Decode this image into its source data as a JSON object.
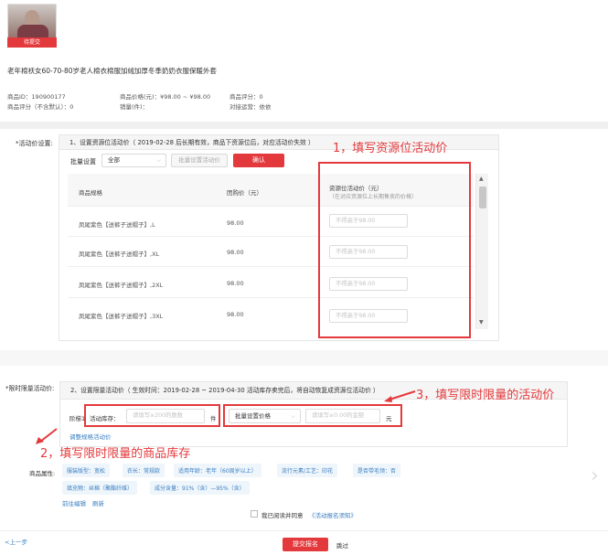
{
  "product": {
    "thumb_button": "待提交",
    "title": "老年棉袄女60-70-80岁老人棉衣棉服加绒加厚冬季奶奶衣服保暖外套",
    "meta": [
      {
        "label": "商品ID：190900177"
      },
      {
        "label": "商品价格(元)：¥98.00 ~ ¥98.00"
      },
      {
        "label": "商品评分：0"
      },
      {
        "label": "商品评分（不含默认）：0"
      },
      {
        "label": "销量(件)："
      },
      {
        "label": "对接运营：依依"
      }
    ]
  },
  "activity_price": {
    "section_label": "*活动价设置:",
    "panel_title": "1、设置资源位活动价（ 2019-02-28 后长期有效，商品下资源位后，对应活动价失效 ）",
    "batch_label": "批量设置",
    "batch_select": "全部",
    "batch_placeholder": "批量设置活动价",
    "confirm_button": "确认",
    "columns": {
      "spec": "商品规格",
      "group_price": "团购价（元）",
      "resource_price": "资源位活动价（元）",
      "resource_price_note": "（在对应资源位上长期售卖的价格）"
    },
    "rows": [
      {
        "spec": "凤尾紫色【送裤子送帽子】,L",
        "price": "98.00",
        "placeholder": "不得高于98.00"
      },
      {
        "spec": "凤尾紫色【送裤子送帽子】,XL",
        "price": "98.00",
        "placeholder": "不得高于98.00"
      },
      {
        "spec": "凤尾紫色【送裤子送帽子】,2XL",
        "price": "98.00",
        "placeholder": "不得高于98.00"
      },
      {
        "spec": "凤尾紫色【送裤子送帽子】,3XL",
        "price": "98.00",
        "placeholder": "不得高于98.00"
      }
    ]
  },
  "limited": {
    "section_label": "*限时限量活动价:",
    "panel_title": "2、设置限量活动价（ 生效时间：2019-02-28 ~ 2019-04-30 活动库存卖完后，将自动恢复成资源位活动价 ）",
    "stage_label": "阶梯1",
    "stock_label": "活动库存：",
    "stock_placeholder": "请填写≥200的数数",
    "stock_unit": "件",
    "price_select": "批量设置价格",
    "price_placeholder": "请填写≤0.00的金额",
    "price_unit": "元",
    "adjust_link": "调整规格活动价"
  },
  "attributes": {
    "label": "商品属性:",
    "tags": [
      "服装版型：宽松",
      "衣长：常规款",
      "适用年龄：老年（60周岁以上）",
      "流行元素/工艺：印花",
      "是否带毛领：否",
      "填充物：丝棉（聚酯纤维）",
      "成分含量：91%（含）—95%（含）"
    ],
    "edit_link": "前往编辑",
    "refresh_link": "刷新"
  },
  "footer": {
    "agree_text": "我已阅读并同意",
    "agree_link": "《活动报名须知》",
    "prev_link": "<上一步",
    "submit_button": "提交报名",
    "skip_link": "跳过"
  },
  "annotations": {
    "a1": "1，填写资源位活动价",
    "a2": "2，填写限时限量的商品库存",
    "a3": "3，填写限时限量的活动价"
  },
  "colors": {
    "accent": "#e4393c",
    "link": "#3a7fc1"
  },
  "icons": [
    "chevron-down-icon",
    "arrow-right-icon",
    "scroll-up-icon",
    "scroll-down-icon",
    "checkbox-icon"
  ]
}
